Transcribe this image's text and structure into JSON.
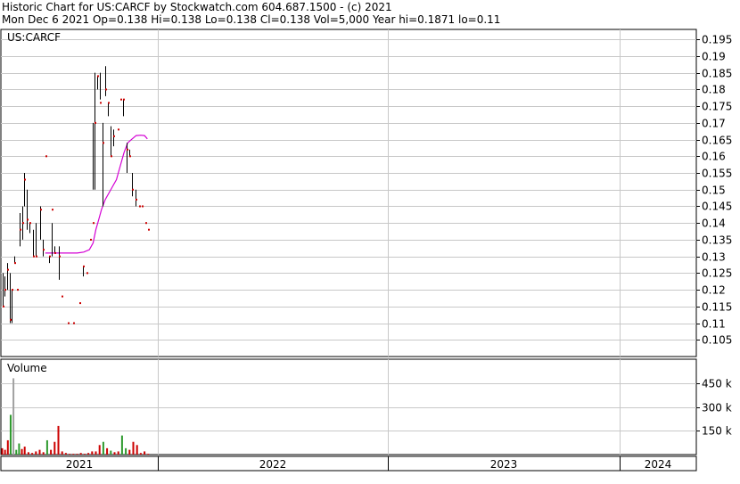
{
  "header": {
    "line1": "Historic Chart for US:CARCF by Stockwatch.com 604.687.1500 - (c) 2021",
    "line2": "Mon Dec  6 2021  Op=0.138  Hi=0.138  Lo=0.138  Cl=0.138  Vol=5,000  Year hi=0.1871  lo=0.11"
  },
  "colors": {
    "bar": "#000000",
    "close_tick": "#cc0000",
    "moving_average": "#d400d4",
    "volume_up": "#2e9a2e",
    "volume_down": "#cc0000",
    "volume_first": "#a0a0a0",
    "grid": "#c8c8c8",
    "frame": "#000000"
  },
  "chart_data": [
    {
      "type": "ohlc",
      "title": "US:CARCF",
      "ylim": [
        0.1,
        0.198
      ],
      "y_ticks": [
        0.105,
        0.11,
        0.115,
        0.12,
        0.125,
        0.13,
        0.135,
        0.14,
        0.145,
        0.15,
        0.155,
        0.16,
        0.165,
        0.17,
        0.175,
        0.18,
        0.185,
        0.19,
        0.195
      ],
      "y_tick_labels": [
        "0.105",
        "0.11",
        "0.115",
        "0.12",
        "0.125",
        "0.13",
        "0.135",
        "0.14",
        "0.145",
        "0.15",
        "0.155",
        "0.16",
        "0.165",
        "0.17",
        "0.175",
        "0.18",
        "0.185",
        "0.19",
        "0.195"
      ],
      "x_period_labels": [
        "2021",
        "2022",
        "2023",
        "2024"
      ],
      "bars": [
        {
          "day": 0,
          "high": 0.125,
          "low": 0.115,
          "close": 0.115
        },
        {
          "day": 2,
          "high": 0.124,
          "low": 0.118,
          "close": 0.12
        },
        {
          "day": 5,
          "high": 0.128,
          "low": 0.12,
          "close": 0.126
        },
        {
          "day": 8,
          "high": 0.125,
          "low": 0.11,
          "close": 0.111
        },
        {
          "day": 10,
          "high": 0.12,
          "low": 0.11,
          "close": 0.12
        },
        {
          "day": 13,
          "high": 0.13,
          "low": 0.128,
          "close": 0.128
        },
        {
          "day": 16,
          "high": 0.12,
          "low": 0.12,
          "close": 0.12
        },
        {
          "day": 19,
          "high": 0.143,
          "low": 0.133,
          "close": 0.138
        },
        {
          "day": 21,
          "high": 0.145,
          "low": 0.135,
          "close": 0.14
        },
        {
          "day": 23,
          "high": 0.155,
          "low": 0.145,
          "close": 0.153
        },
        {
          "day": 26,
          "high": 0.15,
          "low": 0.138,
          "close": 0.141
        },
        {
          "day": 29,
          "high": 0.14,
          "low": 0.137,
          "close": 0.14
        },
        {
          "day": 33,
          "high": 0.138,
          "low": 0.13,
          "close": 0.13
        },
        {
          "day": 36,
          "high": 0.14,
          "low": 0.13,
          "close": 0.13
        },
        {
          "day": 40,
          "high": 0.145,
          "low": 0.135,
          "close": 0.144
        },
        {
          "day": 43,
          "high": 0.135,
          "low": 0.13,
          "close": 0.132
        },
        {
          "day": 46,
          "high": 0.16,
          "low": 0.16,
          "close": 0.16
        },
        {
          "day": 50,
          "high": 0.13,
          "low": 0.128,
          "close": 0.13
        },
        {
          "day": 53,
          "high": 0.14,
          "low": 0.13,
          "close": 0.144
        },
        {
          "day": 56,
          "high": 0.133,
          "low": 0.131,
          "close": 0.131
        },
        {
          "day": 60,
          "high": 0.133,
          "low": 0.123,
          "close": 0.13
        },
        {
          "day": 63,
          "high": 0.118,
          "low": 0.118,
          "close": 0.118
        },
        {
          "day": 70,
          "high": 0.11,
          "low": 0.11,
          "close": 0.11
        },
        {
          "day": 76,
          "high": 0.11,
          "low": 0.11,
          "close": 0.11
        },
        {
          "day": 82,
          "high": 0.116,
          "low": 0.116,
          "close": 0.116
        },
        {
          "day": 86,
          "high": 0.127,
          "low": 0.124,
          "close": 0.127
        },
        {
          "day": 90,
          "high": 0.125,
          "low": 0.125,
          "close": 0.125
        },
        {
          "day": 94,
          "high": 0.135,
          "low": 0.135,
          "close": 0.135
        },
        {
          "day": 97,
          "high": 0.17,
          "low": 0.15,
          "close": 0.14
        },
        {
          "day": 99,
          "high": 0.185,
          "low": 0.15,
          "close": 0.17
        },
        {
          "day": 101,
          "high": 0.184,
          "low": 0.18,
          "close": 0.184
        },
        {
          "day": 104,
          "high": 0.185,
          "low": 0.177,
          "close": 0.176
        },
        {
          "day": 107,
          "high": 0.17,
          "low": 0.145,
          "close": 0.164
        },
        {
          "day": 110,
          "high": 0.187,
          "low": 0.178,
          "close": 0.18
        },
        {
          "day": 113,
          "high": 0.176,
          "low": 0.172,
          "close": 0.176
        },
        {
          "day": 116,
          "high": 0.169,
          "low": 0.16,
          "close": 0.16
        },
        {
          "day": 119,
          "high": 0.168,
          "low": 0.163,
          "close": 0.166
        },
        {
          "day": 123,
          "high": 0.168,
          "low": 0.168,
          "close": 0.168
        },
        {
          "day": 126,
          "high": 0.177,
          "low": 0.177,
          "close": 0.177
        },
        {
          "day": 129,
          "high": 0.177,
          "low": 0.172,
          "close": 0.177
        },
        {
          "day": 133,
          "high": 0.164,
          "low": 0.155,
          "close": 0.162
        },
        {
          "day": 136,
          "high": 0.162,
          "low": 0.16,
          "close": 0.16
        },
        {
          "day": 139,
          "high": 0.155,
          "low": 0.148,
          "close": 0.15
        },
        {
          "day": 142,
          "high": 0.15,
          "low": 0.145,
          "close": 0.147
        },
        {
          "day": 146,
          "high": 0.145,
          "low": 0.145,
          "close": 0.145
        },
        {
          "day": 149,
          "high": 0.145,
          "low": 0.145,
          "close": 0.145
        },
        {
          "day": 153,
          "high": 0.14,
          "low": 0.14,
          "close": 0.14
        },
        {
          "day": 156,
          "high": 0.138,
          "low": 0.138,
          "close": 0.138
        }
      ],
      "moving_average": [
        {
          "day": 46,
          "value": 0.131
        },
        {
          "day": 60,
          "value": 0.131
        },
        {
          "day": 80,
          "value": 0.131
        },
        {
          "day": 87,
          "value": 0.1313
        },
        {
          "day": 93,
          "value": 0.132
        },
        {
          "day": 97,
          "value": 0.134
        },
        {
          "day": 100,
          "value": 0.138
        },
        {
          "day": 103,
          "value": 0.141
        },
        {
          "day": 106,
          "value": 0.144
        },
        {
          "day": 110,
          "value": 0.147
        },
        {
          "day": 114,
          "value": 0.149
        },
        {
          "day": 118,
          "value": 0.151
        },
        {
          "day": 122,
          "value": 0.153
        },
        {
          "day": 126,
          "value": 0.157
        },
        {
          "day": 130,
          "value": 0.161
        },
        {
          "day": 134,
          "value": 0.164
        },
        {
          "day": 138,
          "value": 0.165
        },
        {
          "day": 143,
          "value": 0.1662
        },
        {
          "day": 148,
          "value": 0.1663
        },
        {
          "day": 152,
          "value": 0.1662
        },
        {
          "day": 155,
          "value": 0.1652
        }
      ]
    },
    {
      "type": "bar",
      "title": "Volume",
      "ylim": [
        0,
        600000
      ],
      "y_ticks": [
        150000,
        300000,
        450000
      ],
      "y_tick_labels": [
        "150 k",
        "300 k",
        "450 k"
      ],
      "bars": [
        {
          "day": 0,
          "value": 40000,
          "dir": "down"
        },
        {
          "day": 3,
          "value": 30000,
          "dir": "down"
        },
        {
          "day": 6,
          "value": 90000,
          "dir": "down"
        },
        {
          "day": 9,
          "value": 250000,
          "dir": "up"
        },
        {
          "day": 12,
          "value": 480000,
          "dir": "first"
        },
        {
          "day": 15,
          "value": 30000,
          "dir": "up"
        },
        {
          "day": 18,
          "value": 70000,
          "dir": "up"
        },
        {
          "day": 21,
          "value": 35000,
          "dir": "down"
        },
        {
          "day": 24,
          "value": 50000,
          "dir": "down"
        },
        {
          "day": 28,
          "value": 15000,
          "dir": "down"
        },
        {
          "day": 32,
          "value": 10000,
          "dir": "down"
        },
        {
          "day": 36,
          "value": 20000,
          "dir": "down"
        },
        {
          "day": 40,
          "value": 30000,
          "dir": "down"
        },
        {
          "day": 44,
          "value": 15000,
          "dir": "down"
        },
        {
          "day": 48,
          "value": 90000,
          "dir": "up"
        },
        {
          "day": 52,
          "value": 30000,
          "dir": "down"
        },
        {
          "day": 56,
          "value": 80000,
          "dir": "down"
        },
        {
          "day": 60,
          "value": 180000,
          "dir": "down"
        },
        {
          "day": 64,
          "value": 20000,
          "dir": "down"
        },
        {
          "day": 68,
          "value": 10000,
          "dir": "down"
        },
        {
          "day": 72,
          "value": 5000,
          "dir": "down"
        },
        {
          "day": 76,
          "value": 5000,
          "dir": "down"
        },
        {
          "day": 80,
          "value": 5000,
          "dir": "down"
        },
        {
          "day": 84,
          "value": 10000,
          "dir": "down"
        },
        {
          "day": 88,
          "value": 5000,
          "dir": "down"
        },
        {
          "day": 92,
          "value": 10000,
          "dir": "down"
        },
        {
          "day": 96,
          "value": 20000,
          "dir": "down"
        },
        {
          "day": 100,
          "value": 20000,
          "dir": "down"
        },
        {
          "day": 104,
          "value": 60000,
          "dir": "down"
        },
        {
          "day": 108,
          "value": 80000,
          "dir": "up"
        },
        {
          "day": 112,
          "value": 40000,
          "dir": "down"
        },
        {
          "day": 116,
          "value": 25000,
          "dir": "up"
        },
        {
          "day": 120,
          "value": 15000,
          "dir": "down"
        },
        {
          "day": 124,
          "value": 20000,
          "dir": "down"
        },
        {
          "day": 128,
          "value": 120000,
          "dir": "up"
        },
        {
          "day": 132,
          "value": 40000,
          "dir": "up"
        },
        {
          "day": 136,
          "value": 30000,
          "dir": "down"
        },
        {
          "day": 140,
          "value": 80000,
          "dir": "down"
        },
        {
          "day": 144,
          "value": 60000,
          "dir": "down"
        },
        {
          "day": 148,
          "value": 10000,
          "dir": "down"
        },
        {
          "day": 152,
          "value": 20000,
          "dir": "down"
        },
        {
          "day": 156,
          "value": 5000,
          "dir": "down"
        }
      ]
    }
  ]
}
